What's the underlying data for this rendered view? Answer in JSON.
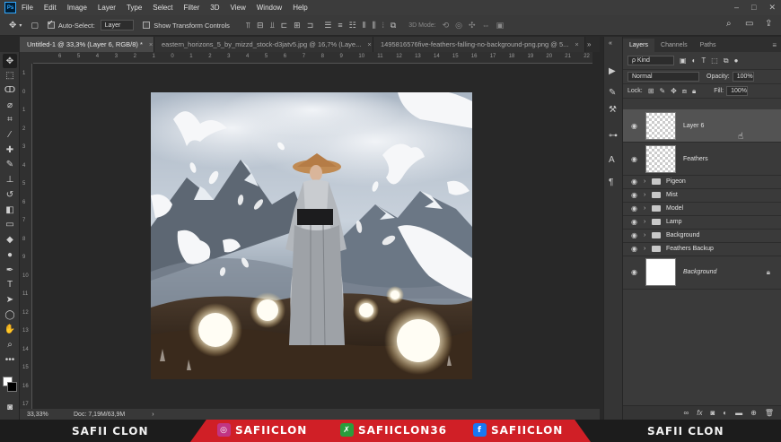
{
  "app": {
    "logo": "Ps",
    "menu": [
      "File",
      "Edit",
      "Image",
      "Layer",
      "Type",
      "Select",
      "Filter",
      "3D",
      "View",
      "Window",
      "Help"
    ],
    "window_buttons": [
      "–",
      "□",
      "✕"
    ]
  },
  "options": {
    "auto_select_label": "Auto-Select:",
    "auto_select_value": "Layer",
    "transform_controls_label": "Show Transform Controls",
    "mode3d_label": "3D Mode:"
  },
  "tabs": [
    {
      "label": "Untitled-1 @ 33,3% (Layer 6, RGB/8) *",
      "active": true
    },
    {
      "label": "eastern_horizons_5_by_mizzd_stock-d3jatv5.jpg @ 16,7% (Laye...",
      "active": false
    },
    {
      "label": "1495816576five-feathers-falling-no-background-png.png @ 5...",
      "active": false
    }
  ],
  "ruler": {
    "top": [
      "6",
      "5",
      "4",
      "3",
      "2",
      "1",
      "0",
      "1",
      "2",
      "3",
      "4",
      "5",
      "6",
      "7",
      "8",
      "9",
      "10",
      "11",
      "12",
      "13",
      "14",
      "15",
      "16",
      "17",
      "18",
      "19",
      "20",
      "21",
      "22"
    ],
    "left": [
      "1",
      "0",
      "1",
      "2",
      "3",
      "4",
      "5",
      "6",
      "7",
      "8",
      "9",
      "10",
      "11",
      "12",
      "13",
      "14",
      "15",
      "16",
      "17"
    ]
  },
  "status": {
    "zoom": "33,33%",
    "doc": "Doc: 7,19M/63,9M",
    "arrow": "›"
  },
  "panel": {
    "tabs": [
      "Layers",
      "Channels",
      "Paths"
    ],
    "kind_label": "ρ Kind",
    "blend_mode": "Normal",
    "opacity_label": "Opacity:",
    "opacity_value": "100%",
    "lock_label": "Lock:",
    "fill_label": "Fill:",
    "fill_value": "100%",
    "layers": [
      {
        "name": "Layer 6",
        "type": "pixel",
        "thumb": "checker",
        "selected": true
      },
      {
        "name": "Feathers",
        "type": "pixel",
        "thumb": "checker",
        "selected": false
      }
    ],
    "groups": [
      "Pigeon",
      "Mist",
      "Model",
      "Lamp",
      "Background",
      "Feathers Backup"
    ],
    "background_layer": {
      "name": "Background",
      "locked": true
    }
  },
  "banner": {
    "left": "SAFII CLON",
    "right": "SAFII CLON",
    "instagram": "SAFIICLON",
    "other": "SAFIICLON36",
    "facebook": "SAFIICLON",
    "colors": {
      "red": "#d01f26",
      "instagram": "#c13584",
      "green": "#2a9d3c",
      "facebook": "#1877f2"
    }
  }
}
